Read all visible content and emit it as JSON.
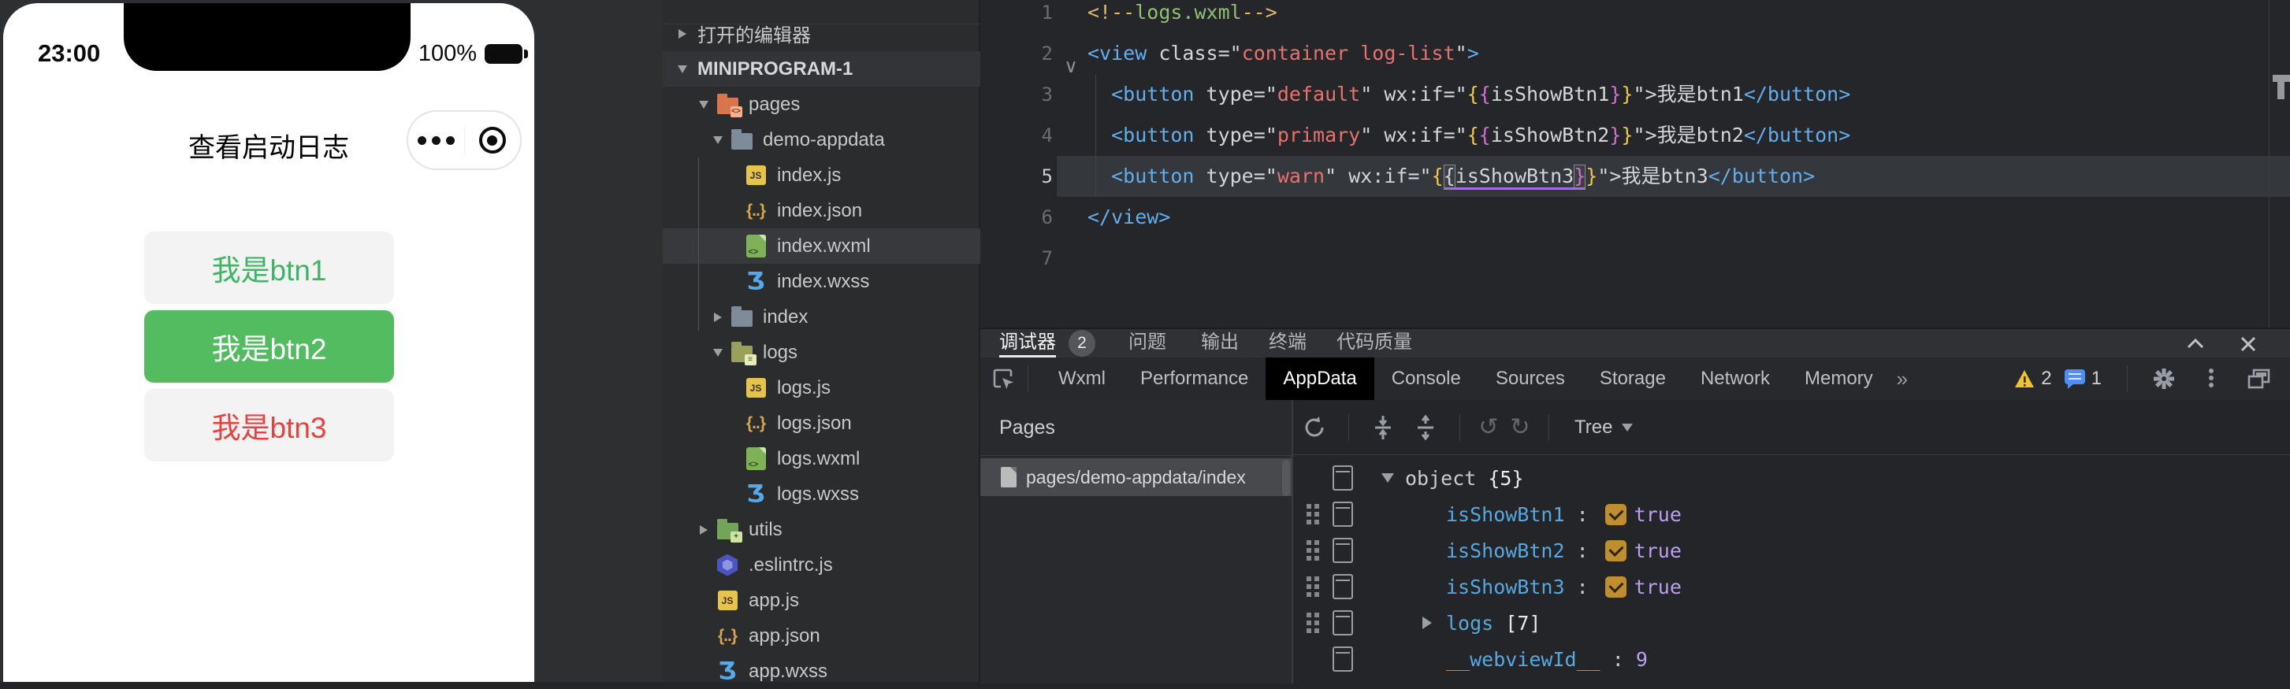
{
  "simulator": {
    "status_time": "23:00",
    "battery_percent": "100%",
    "nav_title": "查看启动日志",
    "buttons": [
      {
        "label": "我是btn1",
        "variant": "default"
      },
      {
        "label": "我是btn2",
        "variant": "primary"
      },
      {
        "label": "我是btn3",
        "variant": "warn"
      }
    ]
  },
  "explorer": {
    "items": [
      {
        "label": "打开的编辑器",
        "depth": 0,
        "arrow": "right",
        "icon": null
      },
      {
        "label": "MINIPROGRAM-1",
        "depth": 0,
        "arrow": "down",
        "icon": null,
        "header": true
      },
      {
        "label": "pages",
        "depth": 1,
        "arrow": "down",
        "icon": "folder-pages"
      },
      {
        "label": "demo-appdata",
        "depth": 2,
        "arrow": "down",
        "icon": "folder-plain"
      },
      {
        "label": "index.js",
        "depth": 3,
        "arrow": null,
        "icon": "js"
      },
      {
        "label": "index.json",
        "depth": 3,
        "arrow": null,
        "icon": "json"
      },
      {
        "label": "index.wxml",
        "depth": 3,
        "arrow": null,
        "icon": "wxml",
        "selected": true
      },
      {
        "label": "index.wxss",
        "depth": 3,
        "arrow": null,
        "icon": "wxss"
      },
      {
        "label": "index",
        "depth": 2,
        "arrow": "right",
        "icon": "folder-plain"
      },
      {
        "label": "logs",
        "depth": 2,
        "arrow": "down",
        "icon": "folder-logs"
      },
      {
        "label": "logs.js",
        "depth": 3,
        "arrow": null,
        "icon": "js"
      },
      {
        "label": "logs.json",
        "depth": 3,
        "arrow": null,
        "icon": "json"
      },
      {
        "label": "logs.wxml",
        "depth": 3,
        "arrow": null,
        "icon": "wxml"
      },
      {
        "label": "logs.wxss",
        "depth": 3,
        "arrow": null,
        "icon": "wxss"
      },
      {
        "label": "utils",
        "depth": 1,
        "arrow": "right",
        "icon": "folder-utils"
      },
      {
        "label": ".eslintrc.js",
        "depth": 1,
        "arrow": null,
        "icon": "eslint"
      },
      {
        "label": "app.js",
        "depth": 1,
        "arrow": null,
        "icon": "js"
      },
      {
        "label": "app.json",
        "depth": 1,
        "arrow": null,
        "icon": "json"
      },
      {
        "label": "app.wxss",
        "depth": 1,
        "arrow": null,
        "icon": "wxss"
      }
    ]
  },
  "editor": {
    "lines": [
      {
        "num": "1",
        "tokens": [
          [
            "<!--",
            "cm"
          ],
          [
            "logs.wxml",
            "cg"
          ],
          [
            "-->",
            "cm"
          ]
        ]
      },
      {
        "num": "2",
        "fold": true,
        "tokens": [
          [
            "<view",
            "b"
          ],
          [
            " ",
            "g"
          ],
          [
            "class",
            "g"
          ],
          [
            "=\"",
            "g"
          ],
          [
            "container log-list",
            "s"
          ],
          [
            "\"",
            "g"
          ],
          [
            ">",
            "b"
          ]
        ]
      },
      {
        "num": "3",
        "tokens": [
          [
            "  ",
            "g"
          ],
          [
            "<button",
            "b"
          ],
          [
            " ",
            "g"
          ],
          [
            "type",
            "g"
          ],
          [
            "=\"",
            "g"
          ],
          [
            "default",
            "s"
          ],
          [
            "\"",
            "g"
          ],
          [
            " ",
            "g"
          ],
          [
            "wx:if",
            "g"
          ],
          [
            "=\"",
            "g"
          ],
          [
            "{",
            "y"
          ],
          [
            "{",
            "m"
          ],
          [
            "isShowBtn1",
            "g"
          ],
          [
            "}",
            "m"
          ],
          [
            "}",
            "y"
          ],
          [
            "\"",
            "g"
          ],
          [
            ">",
            "g"
          ],
          [
            "我是btn1",
            "g"
          ],
          [
            "</button>",
            "b"
          ]
        ]
      },
      {
        "num": "4",
        "tokens": [
          [
            "  ",
            "g"
          ],
          [
            "<button",
            "b"
          ],
          [
            " ",
            "g"
          ],
          [
            "type",
            "g"
          ],
          [
            "=\"",
            "g"
          ],
          [
            "primary",
            "s"
          ],
          [
            "\"",
            "g"
          ],
          [
            " ",
            "g"
          ],
          [
            "wx:if",
            "g"
          ],
          [
            "=\"",
            "g"
          ],
          [
            "{",
            "y"
          ],
          [
            "{",
            "m"
          ],
          [
            "isShowBtn2",
            "g"
          ],
          [
            "}",
            "m"
          ],
          [
            "}",
            "y"
          ],
          [
            "\"",
            "g"
          ],
          [
            ">",
            "g"
          ],
          [
            "我是btn2",
            "g"
          ],
          [
            "</button>",
            "b"
          ]
        ]
      },
      {
        "num": "5",
        "current": true,
        "tokens": [
          [
            "  ",
            "g"
          ],
          [
            "<button",
            "b"
          ],
          [
            " ",
            "g"
          ],
          [
            "type",
            "g"
          ],
          [
            "=\"",
            "g"
          ],
          [
            "warn",
            "s"
          ],
          [
            "\"",
            "g"
          ],
          [
            " ",
            "g"
          ],
          [
            "wx:if",
            "g"
          ],
          [
            "=\"",
            "g"
          ],
          [
            "{",
            "y"
          ],
          [
            "{",
            "g box ul"
          ],
          [
            "isShowBtn3",
            "g ul"
          ],
          [
            "}",
            "m box ul"
          ],
          [
            "}",
            "y"
          ],
          [
            "\"",
            "g"
          ],
          [
            ">",
            "g"
          ],
          [
            "我是btn3",
            "g"
          ],
          [
            "</button>",
            "b"
          ]
        ]
      },
      {
        "num": "6",
        "tokens": [
          [
            "</view>",
            "b"
          ]
        ]
      },
      {
        "num": "7",
        "tokens": []
      }
    ]
  },
  "debugger": {
    "panel_tabs": [
      {
        "label": "调试器",
        "active": true,
        "badge": "2"
      },
      {
        "label": "问题"
      },
      {
        "label": "输出"
      },
      {
        "label": "终端"
      },
      {
        "label": "代码质量"
      }
    ],
    "devtools_tabs": [
      {
        "label": "Wxml"
      },
      {
        "label": "Performance"
      },
      {
        "label": "AppData",
        "active": true
      },
      {
        "label": "Console"
      },
      {
        "label": "Sources"
      },
      {
        "label": "Storage"
      },
      {
        "label": "Network"
      },
      {
        "label": "Memory"
      }
    ],
    "more_tabs_glyph": "»",
    "warning_count": "2",
    "message_count": "1",
    "pages_header": "Pages",
    "page_item": "pages/demo-appdata/index",
    "tree_mode_label": "Tree",
    "appdata_rows": [
      {
        "key": "object",
        "suffix": "{5}",
        "arrow": "down",
        "drag": false,
        "root": true
      },
      {
        "key": "isShowBtn1",
        "value": "true",
        "bool": true,
        "drag": true
      },
      {
        "key": "isShowBtn2",
        "value": "true",
        "bool": true,
        "drag": true
      },
      {
        "key": "isShowBtn3",
        "value": "true",
        "bool": true,
        "drag": true
      },
      {
        "key": "logs",
        "suffix": "[7]",
        "arrow": "right",
        "drag": true
      },
      {
        "key": "__webviewId__",
        "value": "9",
        "bool": false,
        "drag": false
      }
    ]
  }
}
